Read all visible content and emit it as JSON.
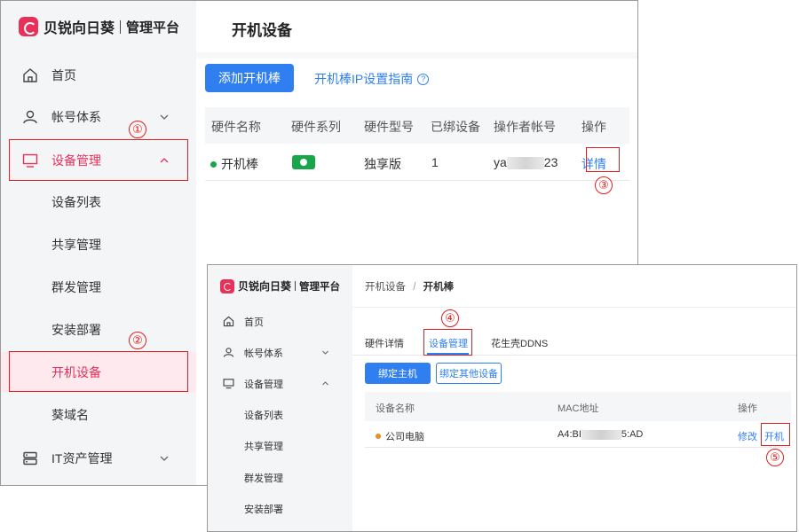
{
  "app": {
    "brand": "贝锐向日葵",
    "platform": "管理平台"
  },
  "colors": {
    "brand": "#e8305a",
    "accent": "#2f7ff0",
    "online": "#19a64a",
    "highlight": "#e02020"
  },
  "window1": {
    "sidebar": [
      {
        "label": "首页",
        "icon": "home-icon"
      },
      {
        "label": "帐号体系",
        "icon": "user-icon"
      },
      {
        "label": "设备管理",
        "icon": "monitor-icon"
      },
      {
        "label": "设备列表"
      },
      {
        "label": "共享管理"
      },
      {
        "label": "群发管理"
      },
      {
        "label": "安装部署"
      },
      {
        "label": "开机设备"
      },
      {
        "label": "葵域名"
      },
      {
        "label": "IT资产管理",
        "icon": "server-icon"
      }
    ],
    "page_title": "开机设备",
    "add_button": "添加开机棒",
    "guide_link": "开机棒IP设置指南",
    "table": {
      "columns": [
        "硬件名称",
        "硬件系列",
        "硬件型号",
        "已绑设备",
        "操作者帐号",
        "操作"
      ],
      "rows": [
        {
          "name": "开机棒",
          "model": "独享版",
          "bound": "1",
          "account_prefix": "ya",
          "account_suffix": "23",
          "action": "详情"
        }
      ]
    }
  },
  "window2": {
    "sidebar": [
      {
        "label": "首页",
        "icon": "home-icon"
      },
      {
        "label": "帐号体系",
        "icon": "user-icon"
      },
      {
        "label": "设备管理",
        "icon": "monitor-icon"
      },
      {
        "label": "设备列表"
      },
      {
        "label": "共享管理"
      },
      {
        "label": "群发管理"
      },
      {
        "label": "安装部署"
      }
    ],
    "breadcrumb": {
      "parent": "开机设备",
      "sep": "/",
      "current": "开机棒"
    },
    "tabs": [
      "硬件详情",
      "设备管理",
      "花生壳DDNS"
    ],
    "bind_host_button": "绑定主机",
    "bind_other_button": "绑定其他设备",
    "table": {
      "columns": [
        "设备名称",
        "MAC地址",
        "操作"
      ],
      "rows": [
        {
          "name": "公司电脑",
          "mac_prefix": "A4:BI",
          "mac_suffix": "5:AD",
          "edit": "修改",
          "power_on": "开机"
        }
      ]
    }
  },
  "markers": [
    "①",
    "②",
    "③",
    "④",
    "⑤"
  ]
}
